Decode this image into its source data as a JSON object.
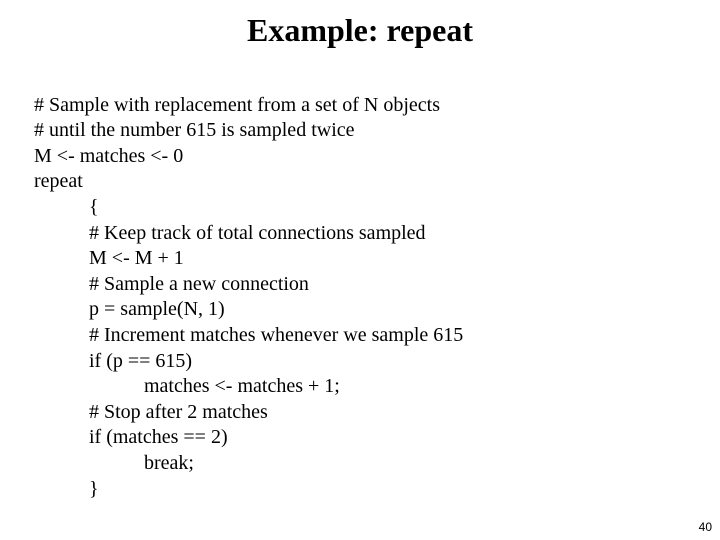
{
  "title": "Example: repeat",
  "code": {
    "l1": "# Sample with replacement from a set of N objects",
    "l2": "# until the number 615 is sampled twice",
    "l3": "M <- matches <- 0",
    "l4": "repeat",
    "l5": "           {",
    "l6": "           # Keep track of total connections sampled",
    "l7": "           M <- M + 1",
    "l8": "           # Sample a new connection",
    "l9": "           p = sample(N, 1)",
    "l10": "           # Increment matches whenever we sample 615",
    "l11": "           if (p == 615)",
    "l12": "                      matches <- matches + 1;",
    "l13": "           # Stop after 2 matches",
    "l14": "           if (matches == 2)",
    "l15": "                      break;",
    "l16": "           }"
  },
  "page_number": "40"
}
